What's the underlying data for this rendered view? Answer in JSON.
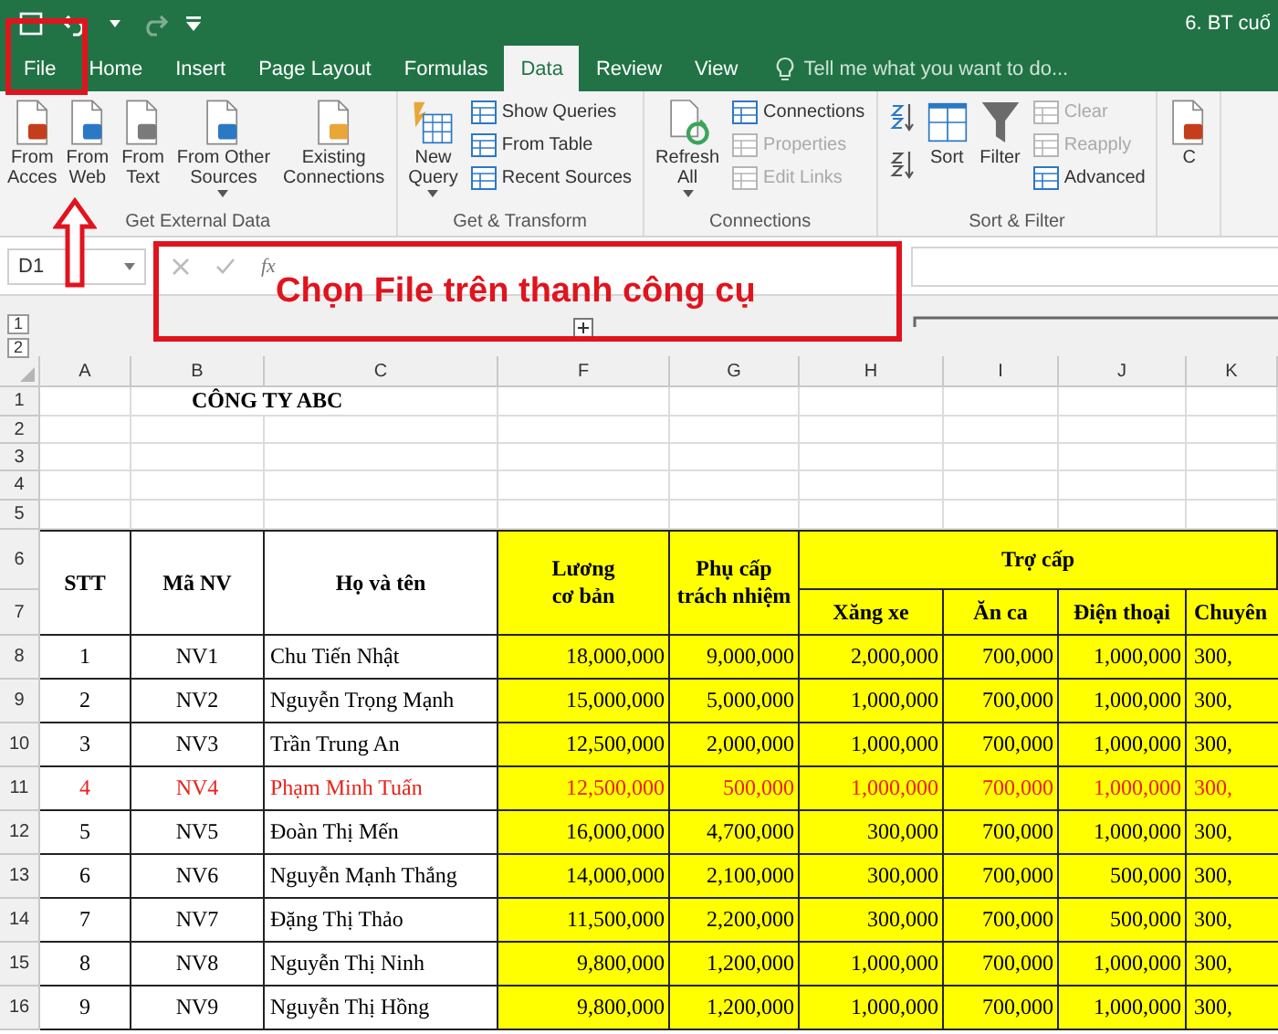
{
  "window": {
    "title": "6. BT cuố"
  },
  "tabs": [
    {
      "label": "File",
      "selected": false
    },
    {
      "label": "Home",
      "selected": false
    },
    {
      "label": "Insert",
      "selected": false
    },
    {
      "label": "Page Layout",
      "selected": false
    },
    {
      "label": "Formulas",
      "selected": false
    },
    {
      "label": "Data",
      "selected": true
    },
    {
      "label": "Review",
      "selected": false
    },
    {
      "label": "View",
      "selected": false
    }
  ],
  "search": {
    "placeholder": "Tell me what you want to do..."
  },
  "ribbon": [
    {
      "label": "Get External Data",
      "items": [
        {
          "kind": "large",
          "label": "From\nAcces",
          "dropdown": false,
          "disabled": false
        },
        {
          "kind": "large",
          "label": "From\nWeb",
          "dropdown": false,
          "disabled": false
        },
        {
          "kind": "large",
          "label": "From\nText",
          "dropdown": false,
          "disabled": false
        },
        {
          "kind": "large",
          "label": "From Other\nSources",
          "dropdown": true,
          "disabled": false
        },
        {
          "kind": "large",
          "label": "Existing\nConnections",
          "dropdown": false,
          "disabled": false
        }
      ]
    },
    {
      "label": "Get & Transform",
      "items": [
        {
          "kind": "large",
          "label": "New\nQuery",
          "dropdown": true,
          "disabled": false
        },
        {
          "kind": "small",
          "label": "Show Queries",
          "disabled": false
        },
        {
          "kind": "small",
          "label": "From Table",
          "disabled": false
        },
        {
          "kind": "small",
          "label": "Recent Sources",
          "disabled": false
        }
      ]
    },
    {
      "label": "Connections",
      "items": [
        {
          "kind": "large",
          "label": "Refresh\nAll",
          "dropdown": true,
          "disabled": false
        },
        {
          "kind": "small",
          "label": "Connections",
          "disabled": false
        },
        {
          "kind": "small",
          "label": "Properties",
          "disabled": true
        },
        {
          "kind": "small",
          "label": "Edit Links",
          "disabled": true
        }
      ]
    },
    {
      "label": "Sort & Filter",
      "items": [
        {
          "kind": "icon",
          "disabled": false
        },
        {
          "kind": "icon",
          "disabled": false
        },
        {
          "kind": "large",
          "label": "Sort",
          "dropdown": false,
          "disabled": false
        },
        {
          "kind": "large",
          "label": "Filter",
          "dropdown": false,
          "disabled": false
        },
        {
          "kind": "small",
          "label": "Clear",
          "disabled": true
        },
        {
          "kind": "small",
          "label": "Reapply",
          "disabled": true
        },
        {
          "kind": "small",
          "label": "Advanced",
          "disabled": false
        }
      ]
    },
    {
      "items": [
        {
          "kind": "large",
          "label": "C",
          "dropdown": false,
          "disabled": false
        }
      ]
    }
  ],
  "formula_bar": {
    "name_box": "D1",
    "function_label": "fx"
  },
  "outline_levels": [
    "1",
    "2"
  ],
  "sheet": {
    "columns": [
      "A",
      "B",
      "C",
      "F",
      "G",
      "H",
      "I",
      "J",
      "K"
    ],
    "title_row": {
      "number": "1",
      "text": "CÔNG TY ABC"
    },
    "blank_rows": [
      "2",
      "3",
      "4",
      "5"
    ],
    "header_row_numbers": [
      "6",
      "7"
    ],
    "header": [
      "STT",
      "Mã NV",
      "Họ và tên",
      "Lương\ncơ bản",
      "Phụ cấp\ntrách nhiệm"
    ],
    "group_header": "Trợ cấp",
    "sub_headers": [
      "Xăng xe",
      "Ăn ca",
      "Điện thoại",
      "Chuyên"
    ],
    "rows": [
      {
        "number": "8",
        "highlighted": false,
        "cells": [
          "1",
          "NV1",
          "Chu Tiến Nhật",
          "18,000,000",
          "9,000,000",
          "2,000,000",
          "700,000",
          "1,000,000",
          "300,"
        ]
      },
      {
        "number": "9",
        "highlighted": false,
        "cells": [
          "2",
          "NV2",
          "Nguyễn Trọng Mạnh",
          "15,000,000",
          "5,000,000",
          "1,000,000",
          "700,000",
          "1,000,000",
          "300,"
        ]
      },
      {
        "number": "10",
        "highlighted": false,
        "cells": [
          "3",
          "NV3",
          "Trần Trung An",
          "12,500,000",
          "2,000,000",
          "1,000,000",
          "700,000",
          "1,000,000",
          "300,"
        ]
      },
      {
        "number": "11",
        "highlighted": true,
        "cells": [
          "4",
          "NV4",
          "Phạm Minh Tuấn",
          "12,500,000",
          "500,000",
          "1,000,000",
          "700,000",
          "1,000,000",
          "300,"
        ]
      },
      {
        "number": "12",
        "highlighted": false,
        "cells": [
          "5",
          "NV5",
          "Đoàn Thị Mến",
          "16,000,000",
          "4,700,000",
          "300,000",
          "700,000",
          "1,000,000",
          "300,"
        ]
      },
      {
        "number": "13",
        "highlighted": false,
        "cells": [
          "6",
          "NV6",
          "Nguyễn Mạnh Thắng",
          "14,000,000",
          "2,100,000",
          "300,000",
          "700,000",
          "500,000",
          "300,"
        ]
      },
      {
        "number": "14",
        "highlighted": false,
        "cells": [
          "7",
          "NV7",
          "Đặng Thị Thảo",
          "11,500,000",
          "2,200,000",
          "300,000",
          "700,000",
          "500,000",
          "300,"
        ]
      },
      {
        "number": "15",
        "highlighted": false,
        "cells": [
          "8",
          "NV8",
          "Nguyễn Thị Ninh",
          "9,800,000",
          "1,200,000",
          "1,000,000",
          "700,000",
          "1,000,000",
          "300,"
        ]
      },
      {
        "number": "16",
        "highlighted": false,
        "cells": [
          "9",
          "NV9",
          "Nguyễn Thị Hồng",
          "9,800,000",
          "1,200,000",
          "1,000,000",
          "700,000",
          "1,000,000",
          "300,"
        ]
      }
    ]
  },
  "annotation": {
    "callout": "Chọn File trên thanh công cụ"
  }
}
